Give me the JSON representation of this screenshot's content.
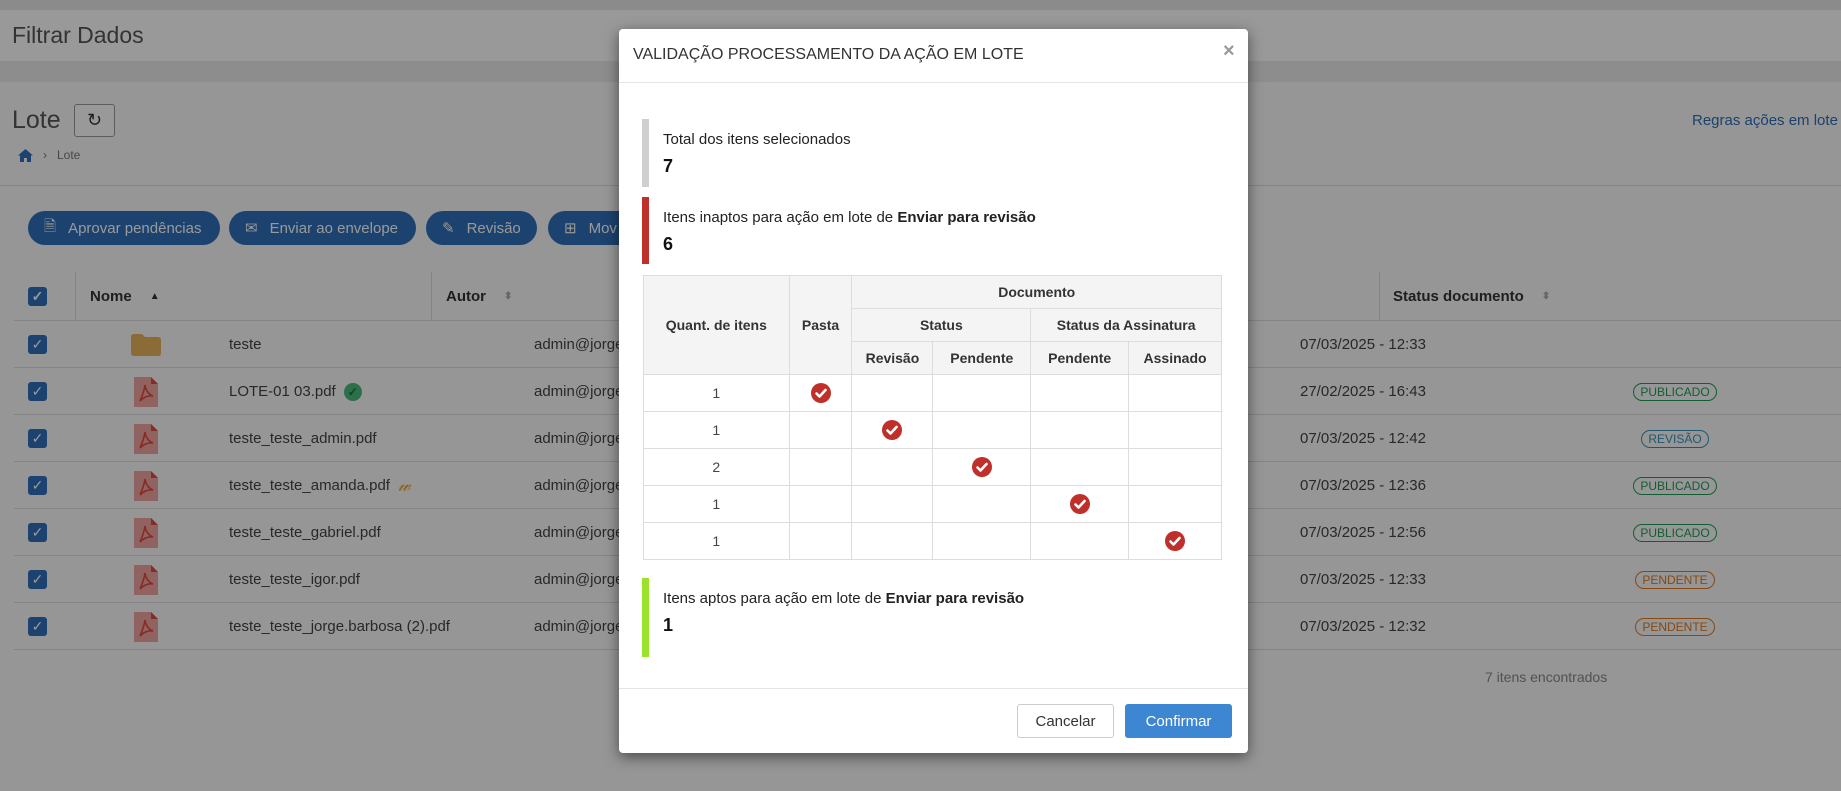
{
  "page": {
    "filter_title": "Filtrar Dados",
    "title": "Lote",
    "breadcrumb": [
      "Lote"
    ],
    "rules_link": "Regras ações em lote",
    "refresh_icon": "refresh-icon"
  },
  "actions": [
    {
      "label": "Aprovar pendências",
      "icon": "file-check-icon"
    },
    {
      "label": "Enviar ao envelope",
      "icon": "envelope-icon"
    },
    {
      "label": "Revisão",
      "icon": "edit-icon"
    },
    {
      "label": "Mov",
      "icon": "move-icon"
    }
  ],
  "table": {
    "headers": {
      "name": "Nome",
      "author": "Autor",
      "status": "Status documento"
    },
    "rows": [
      {
        "type": "folder",
        "name": "teste",
        "author": "admin@jorge",
        "date": "07/03/2025 - 12:33",
        "status": ""
      },
      {
        "type": "pdf",
        "name": "LOTE-01 03.pdf",
        "author": "admin@jorge",
        "date": "27/02/2025 - 16:43",
        "status": "PUBLICADO",
        "mark": "check"
      },
      {
        "type": "pdf",
        "name": "teste_teste_admin.pdf",
        "author": "admin@jorge",
        "date": "07/03/2025 - 12:42",
        "status": "REVISÃO"
      },
      {
        "type": "pdf",
        "name": "teste_teste_amanda.pdf",
        "author": "admin@jorge",
        "date": "07/03/2025 - 12:36",
        "status": "PUBLICADO",
        "mark": "signature"
      },
      {
        "type": "pdf",
        "name": "teste_teste_gabriel.pdf",
        "author": "admin@jorge",
        "date": "07/03/2025 - 12:56",
        "status": "PUBLICADO"
      },
      {
        "type": "pdf",
        "name": "teste_teste_igor.pdf",
        "author": "admin@jorge",
        "date": "07/03/2025 - 12:33",
        "status": "PENDENTE"
      },
      {
        "type": "pdf",
        "name": "teste_teste_jorge.barbosa (2).pdf",
        "author": "admin@jorge",
        "date": "07/03/2025 - 12:32",
        "status": "PENDENTE"
      }
    ],
    "footer": "7 itens encontrados"
  },
  "status_colors": {
    "PUBLICADO": "#1f9d55",
    "REVISÃO": "#3a8fb7",
    "PENDENTE": "#e07b20"
  },
  "modal": {
    "title": "VALIDAÇÃO PROCESSAMENTO DA AÇÃO EM LOTE",
    "close": "×",
    "total": {
      "label": "Total dos itens selecionados",
      "value": "7"
    },
    "inaptos": {
      "label": "Itens inaptos para ação em lote de ",
      "action": "Enviar para revisão",
      "value": "6"
    },
    "aptos": {
      "label": "Itens aptos para ação em lote de ",
      "action": "Enviar para revisão",
      "value": "1"
    },
    "grid": {
      "h_qty": "Quant. de itens",
      "h_pasta": "Pasta",
      "h_doc": "Documento",
      "h_status": "Status",
      "h_sign": "Status da Assinatura",
      "h_revisao": "Revisão",
      "h_pendente": "Pendente",
      "h_sign_pendente": "Pendente",
      "h_assinado": "Assinado",
      "rows": [
        {
          "qty": "1",
          "col": 0
        },
        {
          "qty": "1",
          "col": 1
        },
        {
          "qty": "2",
          "col": 2
        },
        {
          "qty": "1",
          "col": 3
        },
        {
          "qty": "1",
          "col": 4
        }
      ]
    },
    "cancel": "Cancelar",
    "confirm": "Confirmar"
  }
}
